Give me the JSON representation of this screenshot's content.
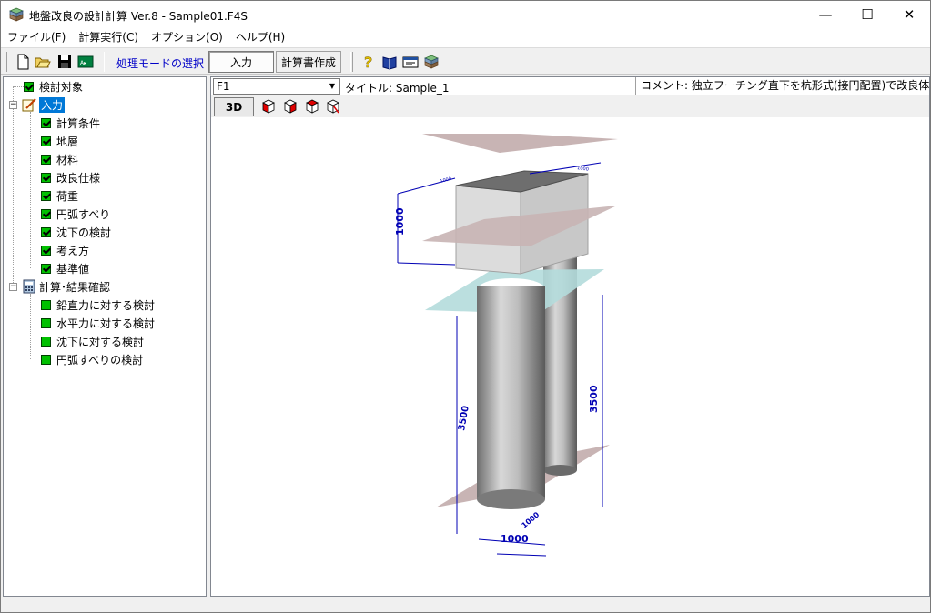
{
  "window": {
    "title": "地盤改良の設計計算 Ver.8 - Sample01.F4S",
    "minimize": "—",
    "maximize": "☐",
    "close": "✕"
  },
  "menu": [
    "ファイル(F)",
    "計算実行(C)",
    "オプション(O)",
    "ヘルプ(H)"
  ],
  "toolbar": {
    "mode_label": "処理モードの選択",
    "input_btn": "入力",
    "report_btn": "計算書作成",
    "icons": [
      "new-file-icon",
      "open-folder-icon",
      "save-icon",
      "export-icon",
      "help-icon",
      "book-icon",
      "card-icon",
      "layers-icon"
    ]
  },
  "tree": {
    "root": "検討対象",
    "input": "入力",
    "input_children": [
      "計算条件",
      "地層",
      "材料",
      "改良仕様",
      "荷重",
      "円弧すべり",
      "沈下の検討",
      "考え方",
      "基準値"
    ],
    "results": "計算･結果確認",
    "results_children": [
      "鉛直力に対する検討",
      "水平力に対する検討",
      "沈下に対する検討",
      "円弧すべりの検討"
    ]
  },
  "main": {
    "case_select": "F1",
    "title_label": "タイトル: Sample_1",
    "comment_label": "コメント: 独立フーチング直下を杭形式(接円配置)で改良体を設",
    "view_3d": "3D",
    "dims": {
      "footing_height": "1000",
      "pile_length_left": "3500",
      "pile_length_right": "3500",
      "pile_spacing": "1000",
      "pile_dia": "1000",
      "small_top": "1000",
      "small_top_right": "1000"
    }
  },
  "colors": {
    "selection": "#0078d7",
    "dim_line": "#0000b4",
    "plate": "#c8b4b4",
    "water_plate": "#b4dcdc",
    "mode_label": "#0000c8",
    "checkbox": "#00c000"
  }
}
